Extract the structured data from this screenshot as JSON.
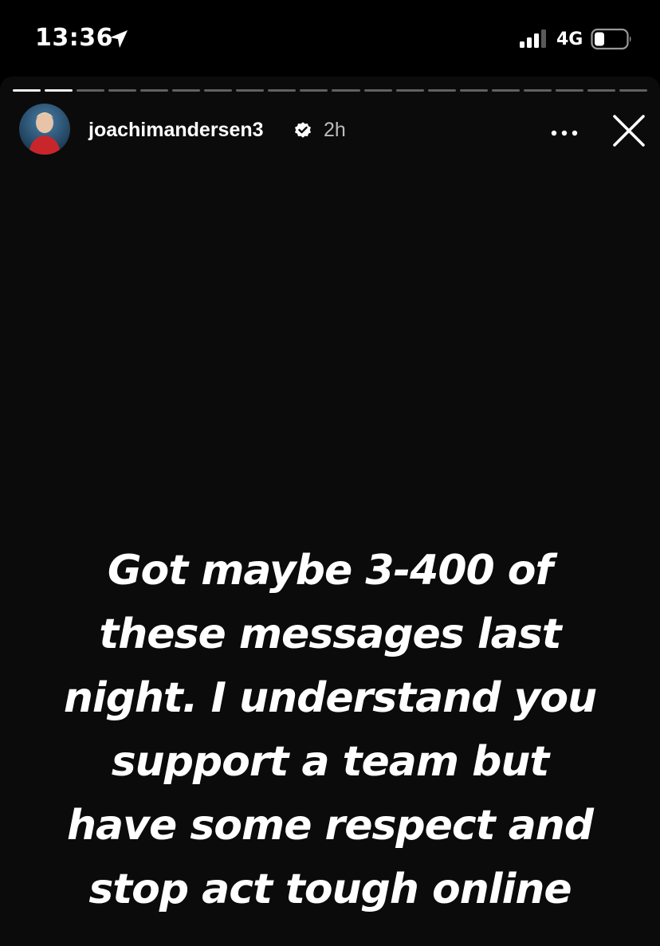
{
  "status_bar": {
    "time": "13:36",
    "network": "4G",
    "icons": [
      "location-arrow-icon",
      "signal-bars-icon",
      "battery-icon"
    ]
  },
  "story": {
    "progress_segments": 20,
    "progress_completed": 2,
    "author": {
      "username": "joachimandersen3",
      "verified": true,
      "posted_ago": "2h"
    },
    "text_lines": [
      "Got maybe 3-400 of",
      "these messages last",
      "night. I understand you",
      "support a team but",
      "have some respect and",
      "stop act tough online"
    ],
    "colors": {
      "background": "#0b0b0b",
      "text": "#ffffff",
      "meta": "#bdbdbd"
    }
  }
}
